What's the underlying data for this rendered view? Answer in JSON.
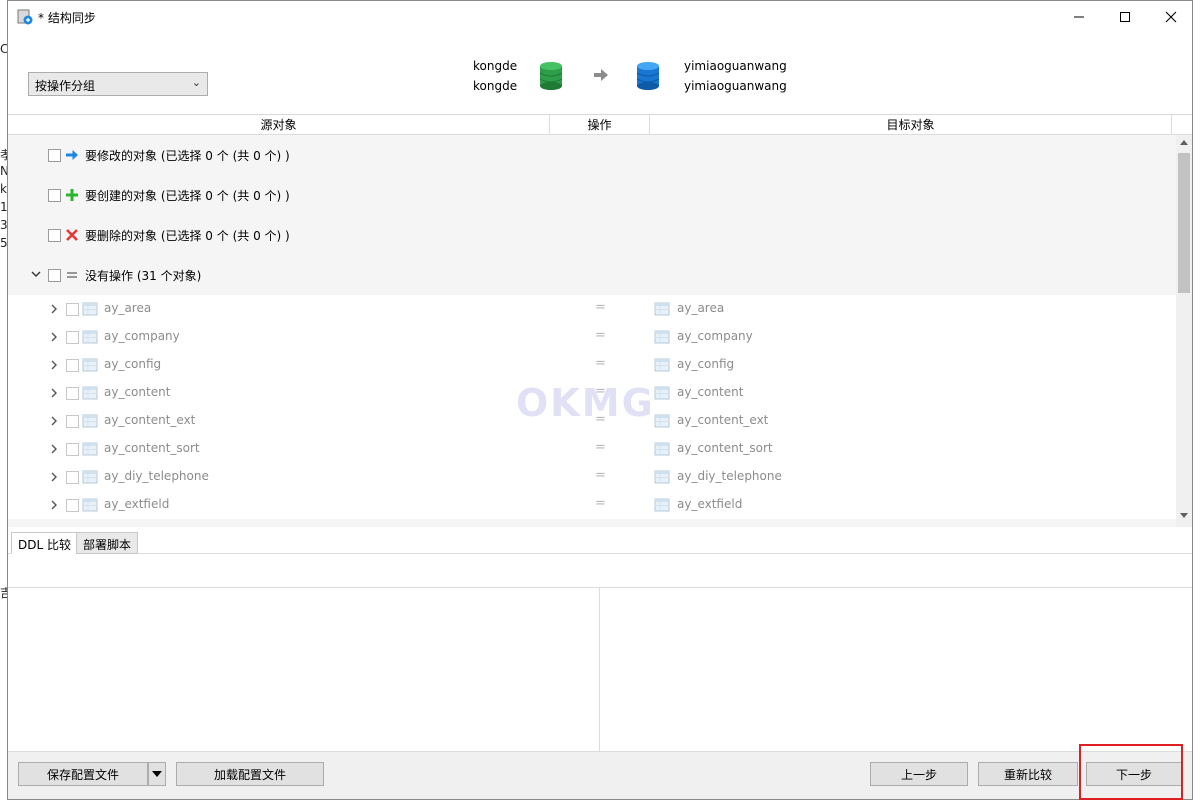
{
  "window": {
    "title": "* 结构同步"
  },
  "header": {
    "group_select": "按操作分组",
    "source": {
      "conn": "kongde",
      "db": "kongde"
    },
    "target": {
      "conn": "yimiaoguanwang",
      "db": "yimiaoguanwang"
    }
  },
  "columns": {
    "source": "源对象",
    "operation": "操作",
    "target": "目标对象"
  },
  "groups": [
    {
      "label": "要修改的对象 (已选择 0 个 (共 0 个) )",
      "icon": "arrow-right-icon",
      "color": "#1e88e5"
    },
    {
      "label": "要创建的对象 (已选择 0 个 (共 0 个) )",
      "icon": "plus-icon",
      "color": "#2bb52b"
    },
    {
      "label": "要删除的对象 (已选择 0 个 (共 0 个) )",
      "icon": "cross-icon",
      "color": "#e53935"
    },
    {
      "label": "没有操作 (31 个对象)",
      "icon": "equals-icon",
      "color": "#777777"
    }
  ],
  "items": [
    {
      "source": "ay_area",
      "op": "=",
      "target": "ay_area"
    },
    {
      "source": "ay_company",
      "op": "=",
      "target": "ay_company"
    },
    {
      "source": "ay_config",
      "op": "=",
      "target": "ay_config"
    },
    {
      "source": "ay_content",
      "op": "=",
      "target": "ay_content"
    },
    {
      "source": "ay_content_ext",
      "op": "=",
      "target": "ay_content_ext"
    },
    {
      "source": "ay_content_sort",
      "op": "=",
      "target": "ay_content_sort"
    },
    {
      "source": "ay_diy_telephone",
      "op": "=",
      "target": "ay_diy_telephone"
    },
    {
      "source": "ay_extfield",
      "op": "=",
      "target": "ay_extfield"
    }
  ],
  "tabs": {
    "ddl": "DDL 比较",
    "script": "部署脚本"
  },
  "watermark": "OKMG",
  "footer": {
    "save": "保存配置文件",
    "load": "加载配置文件",
    "prev": "上一步",
    "recompare": "重新比较",
    "next": "下一步"
  },
  "background_fragments": [
    "C",
    "孝",
    "N",
    "k",
    "1",
    "3",
    "5",
    "吉"
  ]
}
